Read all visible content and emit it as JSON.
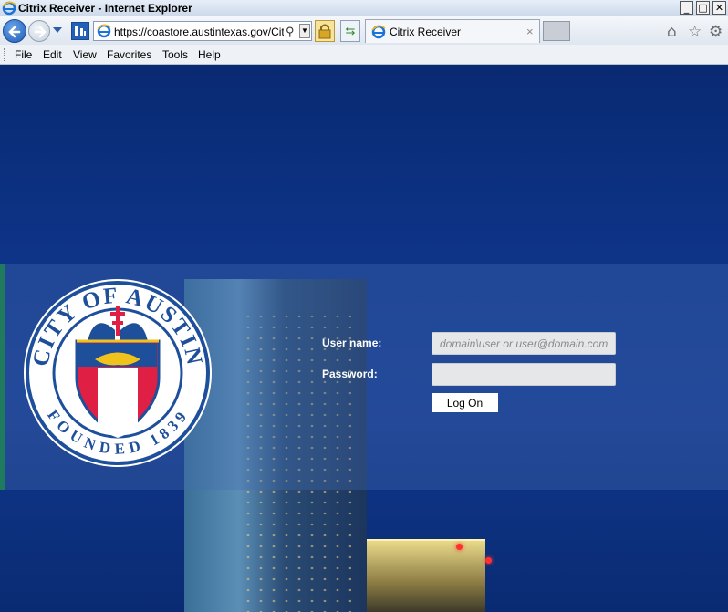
{
  "window": {
    "title": "Citrix Receiver - Internet Explorer",
    "min_glyph": "_",
    "max_glyph": "□",
    "close_glyph": "✕"
  },
  "navbar": {
    "url": "https://coastore.austintexas.gov/Citrix",
    "tab_title": "Citrix Receiver",
    "tab_close_glyph": "×",
    "search_glyph": "⚲",
    "refresh_glyph": "⇆",
    "home_glyph": "⌂",
    "favorites_glyph": "☆",
    "tools_glyph": "⚙"
  },
  "menu": {
    "items": [
      "File",
      "Edit",
      "View",
      "Favorites",
      "Tools",
      "Help"
    ]
  },
  "login": {
    "username_label": "User name:",
    "username_placeholder": "domain\\user or user@domain.com",
    "password_label": "Password:",
    "logon_label": "Log On"
  },
  "seal": {
    "top_text": "CITY OF AUSTIN",
    "bottom_text": "FOUNDED 1839"
  },
  "colors": {
    "background": "#0b2a75",
    "band": "#466eaf",
    "accent_green": "#1f7a5e",
    "seal_blue": "#1d4f9a",
    "seal_red": "#e01f45"
  }
}
